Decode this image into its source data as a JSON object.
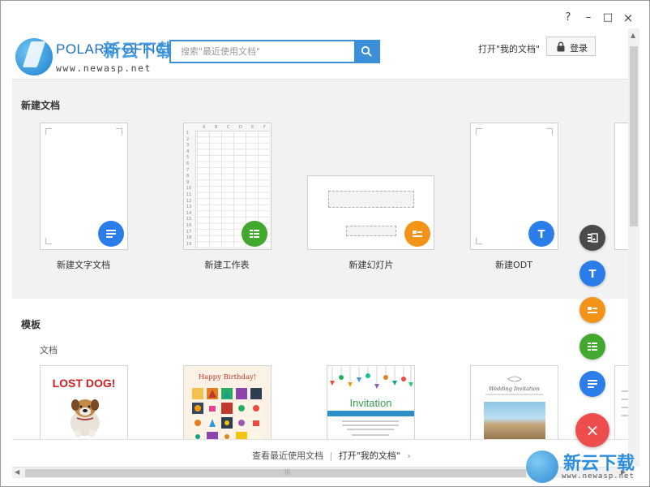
{
  "window": {
    "help_label": "?",
    "minimize_label": "–",
    "maximize_label": "□",
    "close_label": "×"
  },
  "logo": {
    "brand": "POLARIS OFFICE",
    "overlay": "新云下载",
    "url": "www.newasp.net"
  },
  "search": {
    "placeholder": "搜索\"最近使用文档\""
  },
  "header": {
    "open_my_docs": "打开\"我的文档\"",
    "login_label": "登录"
  },
  "new_docs": {
    "title": "新建文档",
    "items": [
      {
        "label": "新建文字文档",
        "icon": "text-doc-icon",
        "color": "#2b7de9"
      },
      {
        "label": "新建工作表",
        "icon": "sheet-icon",
        "color": "#43a82e"
      },
      {
        "label": "新建幻灯片",
        "icon": "slide-icon",
        "color": "#f39419"
      },
      {
        "label": "新建ODT",
        "icon": "odt-icon",
        "color": "#2b7de9"
      }
    ]
  },
  "sheet_preview": {
    "cols": [
      "A",
      "B",
      "C",
      "D",
      "E",
      "F"
    ],
    "rows": [
      "1",
      "2",
      "3",
      "4",
      "5",
      "6",
      "7",
      "8",
      "9",
      "10",
      "11",
      "12",
      "13",
      "14",
      "15",
      "16",
      "17",
      "18",
      "19"
    ]
  },
  "templates": {
    "title": "模板",
    "category": "文档",
    "items": [
      {
        "name": "lost-dog",
        "headline": "LOST DOG!"
      },
      {
        "name": "birthday",
        "headline": "Happy Birthday!"
      },
      {
        "name": "invitation",
        "headline": "Invitation"
      },
      {
        "name": "wedding",
        "headline": "Wedding Invitation"
      }
    ]
  },
  "side_fabs": [
    {
      "name": "presentation-fab",
      "color": "#4a4a4a"
    },
    {
      "name": "odt-fab",
      "color": "#2b7de9"
    },
    {
      "name": "slide-fab",
      "color": "#f39419"
    },
    {
      "name": "sheet-fab",
      "color": "#43a82e"
    },
    {
      "name": "text-doc-fab",
      "color": "#2b7de9"
    }
  ],
  "close_fab": {
    "label": "×",
    "color": "#ee4d4d"
  },
  "footer": {
    "recent": "查看最近使用文档",
    "separator": "|",
    "open_my_docs": "打开\"我的文档\"",
    "chevron": "›"
  },
  "watermark": {
    "text": "新云下载",
    "url": "www.newasp.net"
  },
  "scrollbar": {
    "h_grip": "|||"
  }
}
